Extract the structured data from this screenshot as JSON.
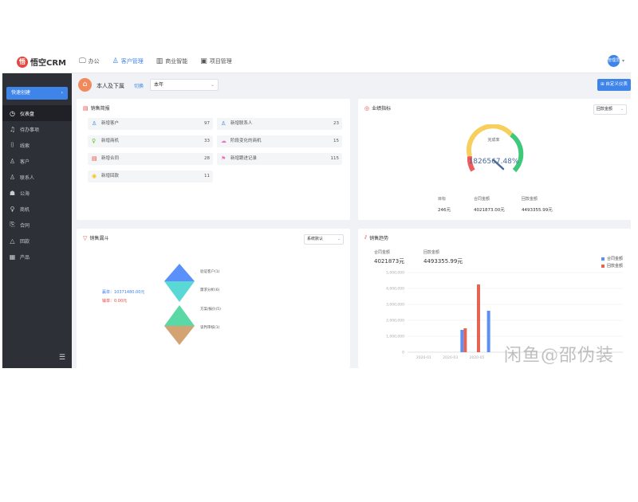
{
  "app": {
    "logo_text": "悟空CRM",
    "brand_color": "#3e84e9",
    "sidebar_color": "#2d3037"
  },
  "topnav": [
    {
      "label": "办公",
      "icon": "monitor-icon"
    },
    {
      "label": "客户管理",
      "icon": "users-icon"
    },
    {
      "label": "商业智能",
      "icon": "bar-chart-icon"
    },
    {
      "label": "项目管理",
      "icon": "briefcase-icon"
    }
  ],
  "user": {
    "avatar_text": "管理员"
  },
  "sidebar": {
    "quick_create": "快速创建",
    "items": [
      {
        "label": "仪表盘",
        "icon": "dashboard-icon"
      },
      {
        "label": "待办事项",
        "icon": "bell-icon"
      },
      {
        "label": "线索",
        "icon": "lead-icon"
      },
      {
        "label": "客户",
        "icon": "customer-icon"
      },
      {
        "label": "联系人",
        "icon": "contact-icon"
      },
      {
        "label": "公海",
        "icon": "pool-icon"
      },
      {
        "label": "商机",
        "icon": "bulb-icon"
      },
      {
        "label": "合同",
        "icon": "contract-icon"
      },
      {
        "label": "回款",
        "icon": "payment-icon"
      },
      {
        "label": "产品",
        "icon": "product-icon"
      }
    ]
  },
  "filter": {
    "scope": "本人及下属",
    "switch": "切换",
    "period": "本年",
    "dashboard_button": "自定义仪表"
  },
  "brief": {
    "title": "销售简报",
    "stats": [
      {
        "label": "新增客户",
        "value": "97",
        "icon": "customer-icon",
        "color": "#3e84e9"
      },
      {
        "label": "新增联系人",
        "value": "23",
        "icon": "contact-icon",
        "color": "#3e84e9"
      },
      {
        "label": "新增商机",
        "value": "33",
        "icon": "bulb-icon",
        "color": "#53c41a"
      },
      {
        "label": "阶段变化的商机",
        "value": "15",
        "icon": "cloud-icon",
        "color": "#e873c0"
      },
      {
        "label": "新增合同",
        "value": "28",
        "icon": "contract-icon",
        "color": "#e8453c"
      },
      {
        "label": "新增跟进记录",
        "value": "115",
        "icon": "follow-icon",
        "color": "#e873c0"
      },
      {
        "label": "新增回款",
        "value": "11",
        "icon": "payment-icon",
        "color": "#f5c518"
      }
    ]
  },
  "performance": {
    "title": "业绩指标",
    "selector": "回款金额",
    "gauge_label": "完成率",
    "gauge_value": "1826567.48%",
    "completion_fraction": 0.7,
    "columns": [
      {
        "label": "目标",
        "value": "246元"
      },
      {
        "label": "合同金额",
        "value": "4021873.00元"
      },
      {
        "label": "回款金额",
        "value": "4493355.99元"
      }
    ]
  },
  "funnel": {
    "title": "销售漏斗",
    "selector": "系统默认",
    "won": "赢单：10371480.00元",
    "lost": "输单：0.00元",
    "stages": [
      {
        "label": "验证客户(1)",
        "color": "#5b8ff9"
      },
      {
        "label": "需求分析(6)",
        "color": "#5ad8d6"
      },
      {
        "label": "方案/报价(5)",
        "color": "#5ad8a6"
      },
      {
        "label": "谈判审核(1)",
        "color": "#d4a373"
      }
    ]
  },
  "trend": {
    "title": "销售趋势",
    "contract_label": "合同金额",
    "contract_value": "4021873元",
    "payment_label": "回款金额",
    "payment_value": "4493355.99元",
    "legend": [
      {
        "name": "合同金额",
        "color": "#5b8ff9"
      },
      {
        "name": "回款金额",
        "color": "#e86452"
      }
    ]
  },
  "chart_data": {
    "type": "bar",
    "categories": [
      "2020-01",
      "",
      "2020-03",
      "",
      "2020-05",
      ""
    ],
    "series": [
      {
        "name": "合同金额",
        "color": "#5b8ff9",
        "values": [
          0,
          0,
          0,
          1400000,
          0,
          2600000
        ]
      },
      {
        "name": "回款金额",
        "color": "#e86452",
        "values": [
          0,
          0,
          0,
          1500000,
          4250000,
          0
        ]
      }
    ],
    "yticks": [
      "0",
      "1,000,000",
      "2,000,000",
      "3,000,000",
      "4,000,000",
      "5,000,000"
    ],
    "ylim": [
      0,
      5000000
    ]
  },
  "watermark": "闲鱼@邵伪装"
}
